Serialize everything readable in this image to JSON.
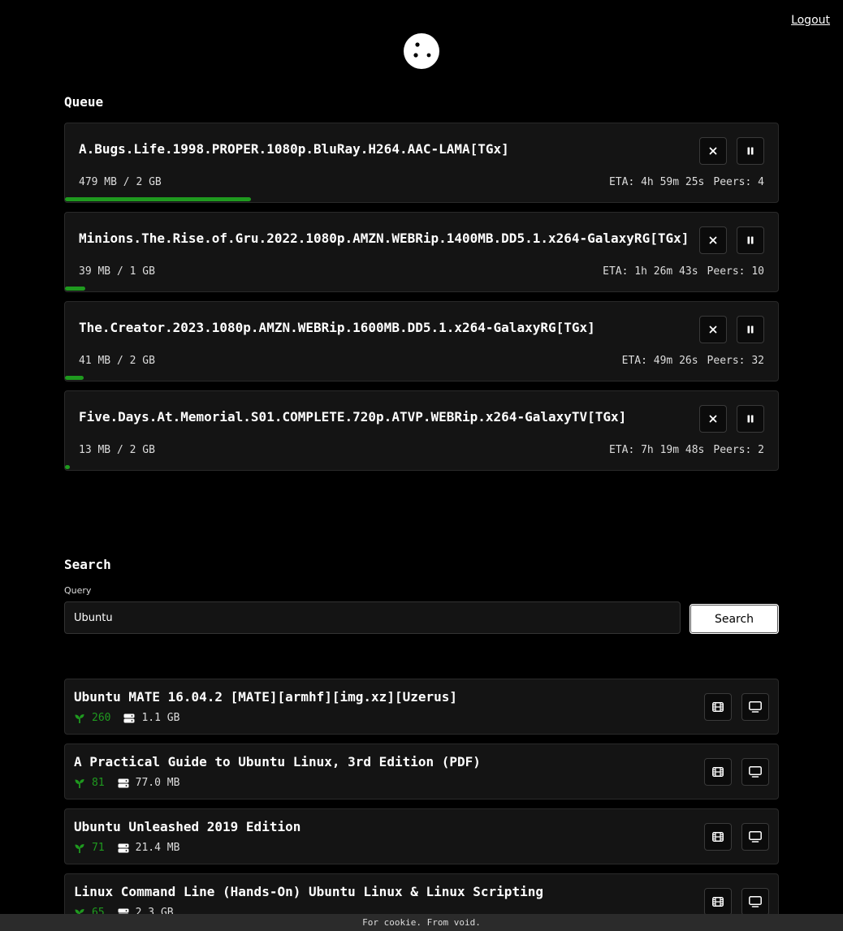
{
  "header": {
    "logout_label": "Logout"
  },
  "queue": {
    "title": "Queue",
    "items": [
      {
        "name": "A.Bugs.Life.1998.PROPER.1080p.BluRay.H264.AAC-LAMA[TGx]",
        "size": "479 MB / 2 GB",
        "eta": "ETA: 4h 59m 25s",
        "peers": "Peers: 4",
        "progress": 0.26
      },
      {
        "name": "Minions.The.Rise.of.Gru.2022.1080p.AMZN.WEBRip.1400MB.DD5.1.x264-GalaxyRG[TGx]",
        "size": "39 MB / 1 GB",
        "eta": "ETA: 1h 26m 43s",
        "peers": "Peers: 10",
        "progress": 0.028
      },
      {
        "name": "The.Creator.2023.1080p.AMZN.WEBRip.1600MB.DD5.1.x264-GalaxyRG[TGx]",
        "size": "41 MB / 2 GB",
        "eta": "ETA: 49m 26s",
        "peers": "Peers: 32",
        "progress": 0.026
      },
      {
        "name": "Five.Days.At.Memorial.S01.COMPLETE.720p.ATVP.WEBRip.x264-GalaxyTV[TGx]",
        "size": "13 MB / 2 GB",
        "eta": "ETA: 7h 19m 48s",
        "peers": "Peers: 2",
        "progress": 0.007
      }
    ]
  },
  "search": {
    "title": "Search",
    "query_label": "Query",
    "query_value": "Ubuntu",
    "button_label": "Search"
  },
  "results": [
    {
      "name": "Ubuntu MATE 16.04.2 [MATE][armhf][img.xz][Uzerus]",
      "seeds": "260",
      "size": "1.1 GB"
    },
    {
      "name": "A Practical Guide to Ubuntu Linux, 3rd Edition (PDF)",
      "seeds": "81",
      "size": "77.0 MB"
    },
    {
      "name": "Ubuntu Unleashed 2019 Edition",
      "seeds": "71",
      "size": "21.4 MB"
    },
    {
      "name": "Linux Command Line (Hands-On) Ubuntu Linux & Linux Scripting",
      "seeds": "65",
      "size": "2.3 GB"
    }
  ],
  "footer": {
    "text": "For cookie. From void."
  },
  "colors": {
    "accent": "#1f9a1f",
    "card": "#141414",
    "background": "#000000"
  },
  "icons": {
    "logo": "cookie-icon",
    "cancel": "close-icon",
    "pause": "pause-icon",
    "movie": "film-icon",
    "tv": "monitor-icon",
    "seed": "seedling-icon",
    "size": "drive-icon"
  }
}
